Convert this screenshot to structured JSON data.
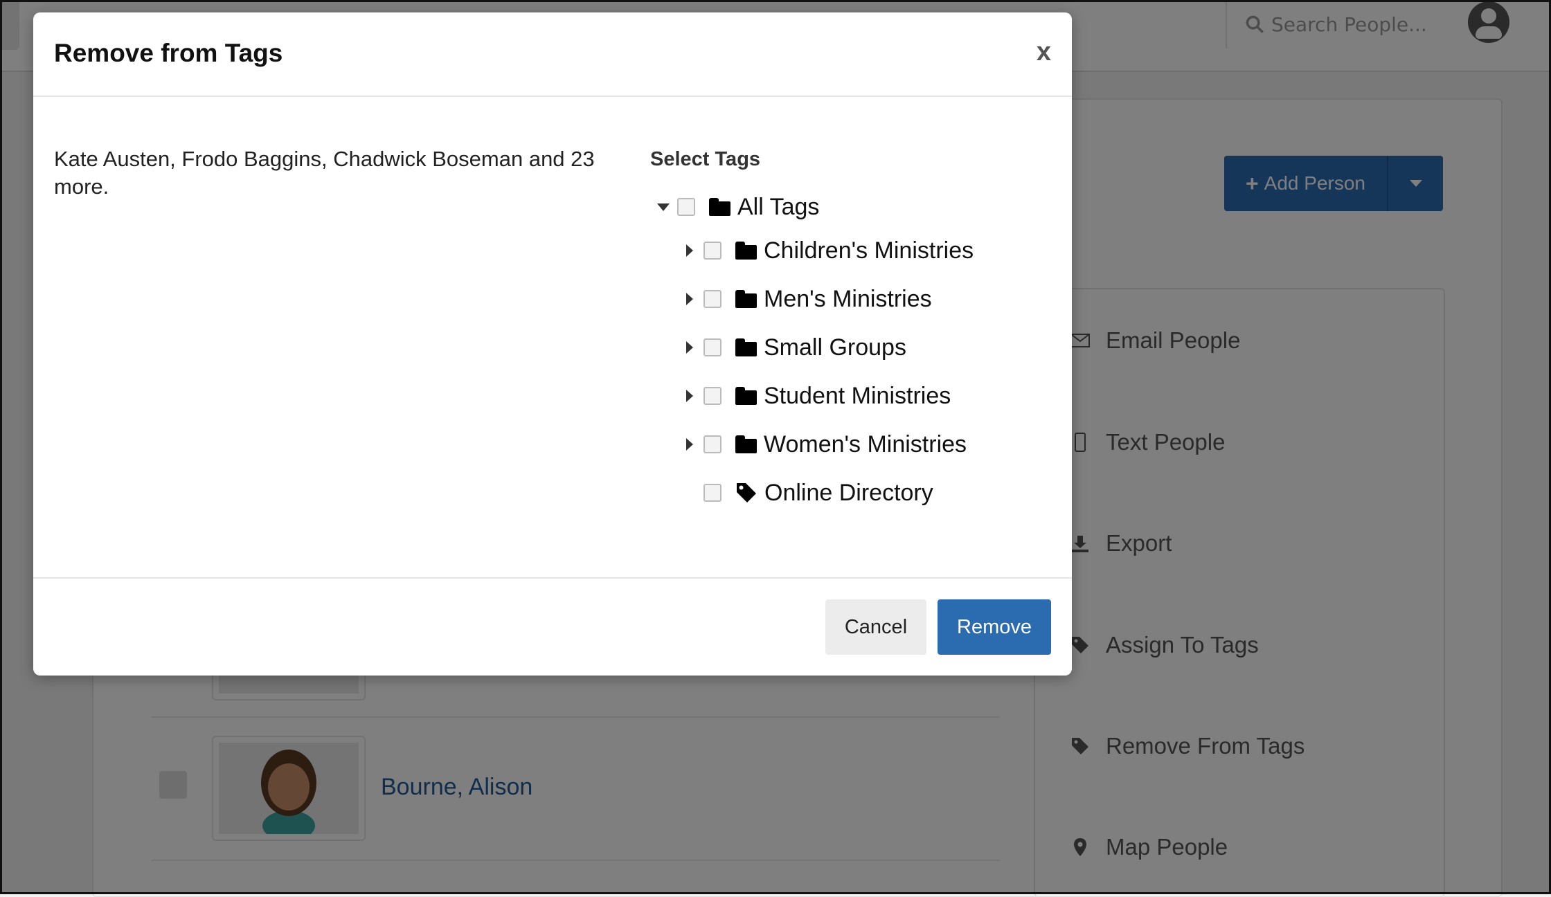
{
  "background": {
    "search_placeholder": "Search People...",
    "add_person_label": "Add Person",
    "actions": [
      {
        "label": "Email People",
        "icon": "envelope-icon"
      },
      {
        "label": "Text People",
        "icon": "phone-icon"
      },
      {
        "label": "Export",
        "icon": "download-icon"
      },
      {
        "label": "Assign To Tags",
        "icon": "tag-icon"
      },
      {
        "label": "Remove From Tags",
        "icon": "tag-icon"
      },
      {
        "label": "Map People",
        "icon": "map-marker-icon"
      }
    ],
    "person_name": "Bourne, Alison"
  },
  "modal": {
    "title": "Remove from Tags",
    "close_label": "x",
    "selected_people": "Kate Austen, Frodo Baggins, Chadwick Boseman and 23 more.",
    "select_tags_label": "Select Tags",
    "tree": {
      "root": {
        "label": "All Tags",
        "expanded": true,
        "checked": false
      },
      "children": [
        {
          "label": "Children's Ministries",
          "type": "folder",
          "expanded": false,
          "checked": false
        },
        {
          "label": "Men's Ministries",
          "type": "folder",
          "expanded": false,
          "checked": false
        },
        {
          "label": "Small Groups",
          "type": "folder",
          "expanded": false,
          "checked": false
        },
        {
          "label": "Student Ministries",
          "type": "folder",
          "expanded": false,
          "checked": false
        },
        {
          "label": "Women's Ministries",
          "type": "folder",
          "expanded": false,
          "checked": false
        },
        {
          "label": "Online Directory",
          "type": "tag",
          "checked": false
        }
      ]
    },
    "cancel_label": "Cancel",
    "remove_label": "Remove"
  },
  "colors": {
    "primary": "#2b6cb0",
    "link": "#215a96",
    "overlay": "rgba(0,0,0,0.5)"
  }
}
